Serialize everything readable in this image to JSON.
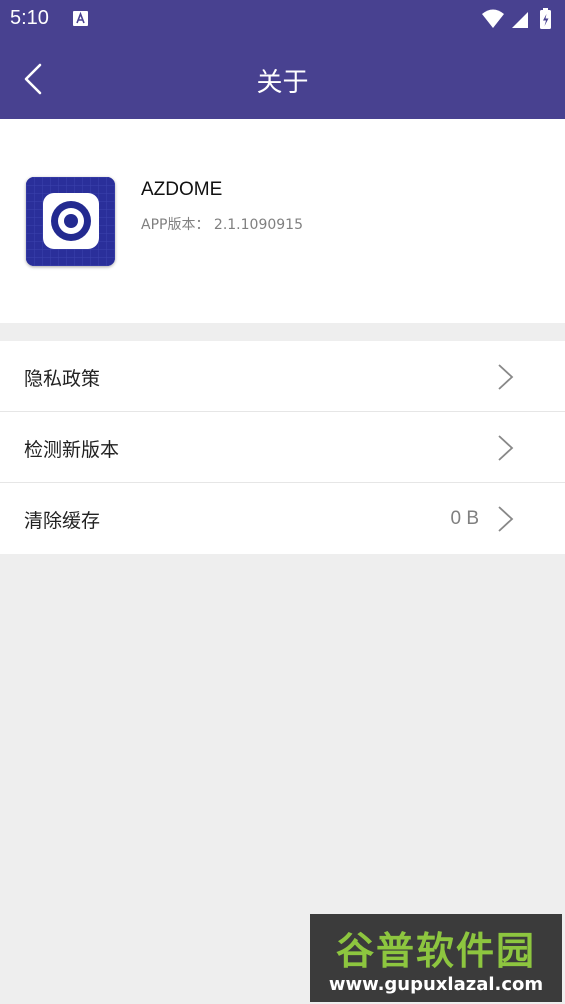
{
  "status_bar": {
    "time": "5:10"
  },
  "header": {
    "title": "关于"
  },
  "app_info": {
    "name": "AZDOME",
    "version": "APP版本： 2.1.1090915"
  },
  "menu": {
    "items": [
      {
        "label": "隐私政策",
        "value": ""
      },
      {
        "label": "检测新版本",
        "value": ""
      },
      {
        "label": "清除缓存",
        "value": "0 B"
      }
    ]
  },
  "watermark": {
    "cn": "谷普软件园",
    "en": "www.gupuxlazal.com"
  },
  "colors": {
    "primary": "#484190",
    "background": "#eeeeee",
    "card": "#ffffff"
  }
}
